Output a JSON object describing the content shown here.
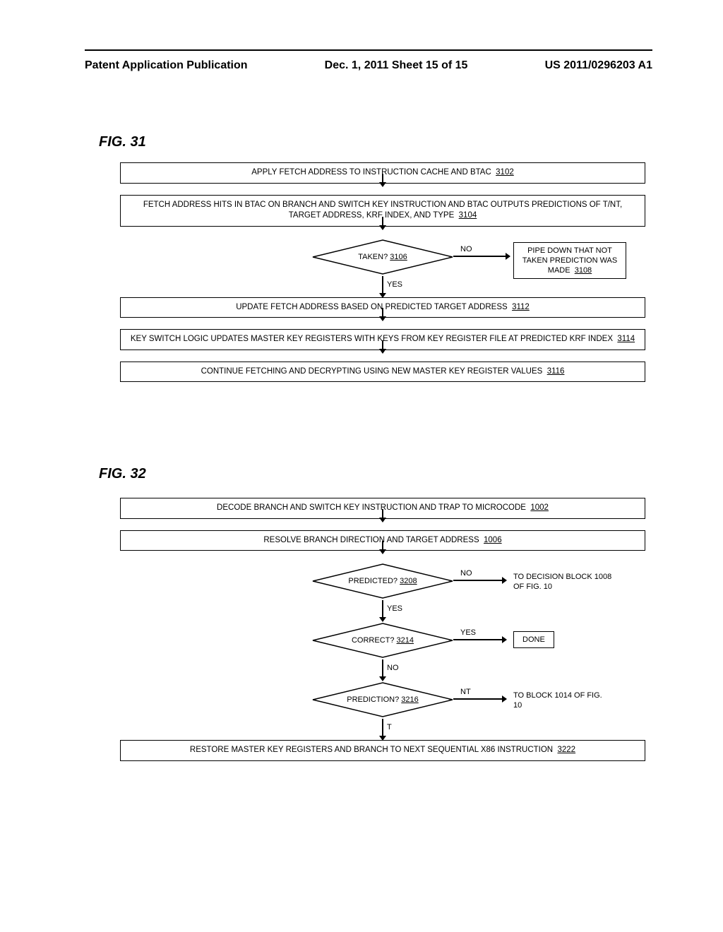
{
  "header": {
    "left": "Patent Application Publication",
    "center": "Dec. 1, 2011  Sheet 15 of 15",
    "right": "US 2011/0296203 A1"
  },
  "fig31": {
    "label": "FIG. 31",
    "box1": {
      "text": "APPLY FETCH ADDRESS TO INSTRUCTION CACHE AND BTAC",
      "ref": "3102"
    },
    "box2": {
      "text": "FETCH ADDRESS HITS IN BTAC ON BRANCH AND SWITCH KEY INSTRUCTION AND BTAC OUTPUTS PREDICTIONS OF T/NT, TARGET ADDRESS, KRF INDEX, AND TYPE",
      "ref": "3104"
    },
    "decision1": {
      "text": "TAKEN?",
      "ref": "3106",
      "no": "NO",
      "yes": "YES"
    },
    "sidebox1": {
      "text": "PIPE DOWN THAT NOT TAKEN PREDICTION WAS MADE",
      "ref": "3108"
    },
    "box3": {
      "text": "UPDATE FETCH ADDRESS BASED ON PREDICTED TARGET ADDRESS",
      "ref": "3112"
    },
    "box4": {
      "text": "KEY SWITCH LOGIC UPDATES MASTER KEY REGISTERS WITH KEYS FROM KEY REGISTER FILE AT PREDICTED KRF INDEX",
      "ref": "3114"
    },
    "box5": {
      "text": "CONTINUE FETCHING AND DECRYPTING USING NEW MASTER KEY REGISTER VALUES",
      "ref": "3116"
    }
  },
  "fig32": {
    "label": "FIG. 32",
    "box1": {
      "text": "DECODE BRANCH AND SWITCH KEY INSTRUCTION AND TRAP TO MICROCODE",
      "ref": "1002"
    },
    "box2": {
      "text": "RESOLVE BRANCH DIRECTION AND TARGET ADDRESS",
      "ref": "1006"
    },
    "decision1": {
      "text": "PREDICTED?",
      "ref": "3208",
      "no": "NO",
      "yes": "YES"
    },
    "sidetext1": "TO DECISION BLOCK 1008 OF FIG. 10",
    "decision2": {
      "text": "CORRECT?",
      "ref": "3214",
      "yes": "YES",
      "no": "NO"
    },
    "sidebox2": {
      "text": "DONE"
    },
    "decision3": {
      "text": "PREDICTION?",
      "ref": "3216",
      "nt": "NT",
      "t": "T"
    },
    "sidetext3": "TO BLOCK 1014 OF FIG. 10",
    "box3": {
      "text": "RESTORE MASTER KEY REGISTERS AND BRANCH TO NEXT SEQUENTIAL X86 INSTRUCTION",
      "ref": "3222"
    }
  }
}
